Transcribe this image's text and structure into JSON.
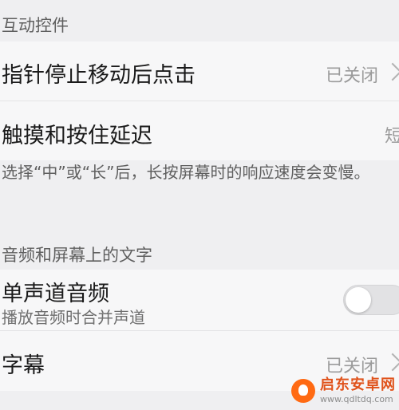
{
  "sections": {
    "interaction_controls": {
      "header": "互动控件",
      "pointer_click": {
        "title": "指针停止移动后点击",
        "value": "已关闭"
      },
      "touch_hold_delay": {
        "title": "触摸和按住延迟",
        "value": "短"
      },
      "note": "选择“中”或“长”后，长按屏幕时的响应速度会变慢。"
    },
    "audio_screen_text": {
      "header": "音频和屏幕上的文字",
      "mono_audio": {
        "title": "单声道音频",
        "subtitle": "播放音频时合并声道",
        "toggle_on": false
      },
      "captions": {
        "title": "字幕",
        "value": "已关闭"
      }
    }
  },
  "watermark": {
    "title": "启东安卓网",
    "url": "www.qdltdq.com"
  },
  "colors": {
    "background": "#efeff1",
    "row_background": "#f7f7f8",
    "watermark_orange": "#ff6a13"
  }
}
